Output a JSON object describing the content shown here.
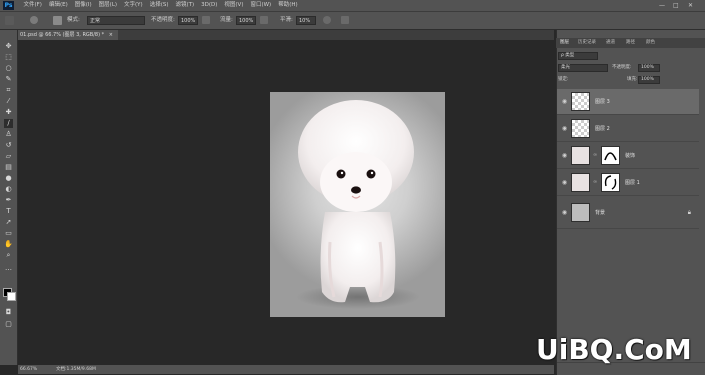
{
  "menubar": {
    "logo": "Ps",
    "items": [
      "文件(F)",
      "编辑(E)",
      "图像(I)",
      "图层(L)",
      "文字(Y)",
      "选择(S)",
      "滤镜(T)",
      "3D(D)",
      "视图(V)",
      "窗口(W)",
      "帮助(H)"
    ],
    "window_controls": {
      "minimize": "—",
      "maximize": "□",
      "close": "✕"
    }
  },
  "options": {
    "mode_label": "模式:",
    "mode_value": "正常",
    "opacity_label": "不透明度:",
    "opacity_value": "100%",
    "flow_label": "流量:",
    "flow_value": "100%",
    "smoothing_label": "平滑:",
    "smoothing_value": "10%"
  },
  "document": {
    "tab_title": "01.psd @ 66.7% (图层 3, RGB/8) *",
    "tab_close": "×"
  },
  "status": {
    "zoom": "66.67%",
    "doc_info": "文档:1.35M/9.68M"
  },
  "panel": {
    "tabs": [
      "图层",
      "历史记录",
      "通道",
      "路径",
      "颜色"
    ],
    "kind_label": "ρ 类型",
    "blend_mode": "柔光",
    "opacity_label": "不透明度:",
    "opacity_value": "100%",
    "lock_label": "锁定:",
    "fill_label": "填充:",
    "fill_value": "100%",
    "layers": [
      {
        "name": "图层 3",
        "active": true,
        "has_mask": false,
        "locked": false
      },
      {
        "name": "图层 2",
        "active": false,
        "has_mask": false,
        "locked": false
      },
      {
        "name": "装饰",
        "active": false,
        "has_mask": true,
        "locked": false
      },
      {
        "name": "图层 1",
        "active": false,
        "has_mask": true,
        "locked": false
      },
      {
        "name": "背景",
        "active": false,
        "has_mask": false,
        "locked": true
      }
    ]
  },
  "watermark": "UiBQ.CoM",
  "colors": {
    "ui_dark": "#282828",
    "ui_panel": "#535353",
    "active_layer": "#6a6a6a"
  }
}
